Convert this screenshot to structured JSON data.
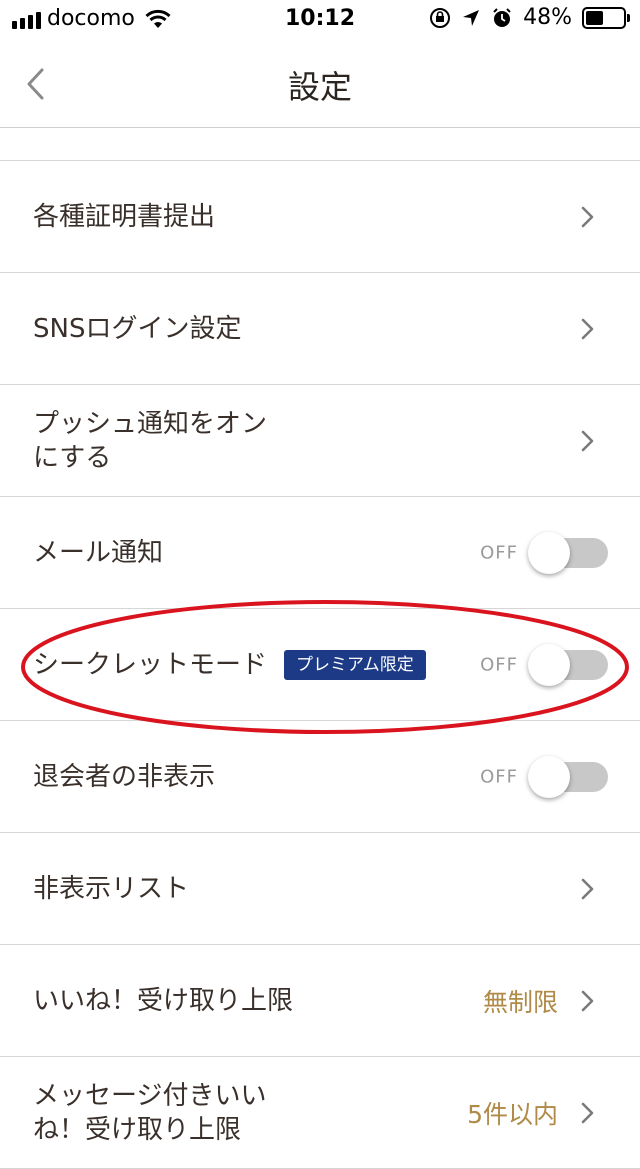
{
  "status_bar": {
    "carrier": "docomo",
    "time": "10:12",
    "battery": "48%",
    "battery_level": 0.48
  },
  "nav": {
    "title": "設定"
  },
  "rows": [
    {
      "label": "各種証明書提出"
    },
    {
      "label": "SNSログイン設定"
    },
    {
      "label": "プッシュ通知をオンにする"
    },
    {
      "label": "メール通知",
      "state": "OFF"
    },
    {
      "label": "シークレットモード",
      "badge": "プレミアム限定",
      "state": "OFF"
    },
    {
      "label": "退会者の非表示",
      "state": "OFF"
    },
    {
      "label": "非表示リスト"
    },
    {
      "label": "いいね！受け取り上限",
      "value": "無制限"
    },
    {
      "label": "メッセージ付きいいね！受け取り上限",
      "value": "5件以内"
    }
  ],
  "colors": {
    "accent_value": "#b08a47",
    "badge_bg": "#1c3a86",
    "highlight": "#d9141e"
  }
}
